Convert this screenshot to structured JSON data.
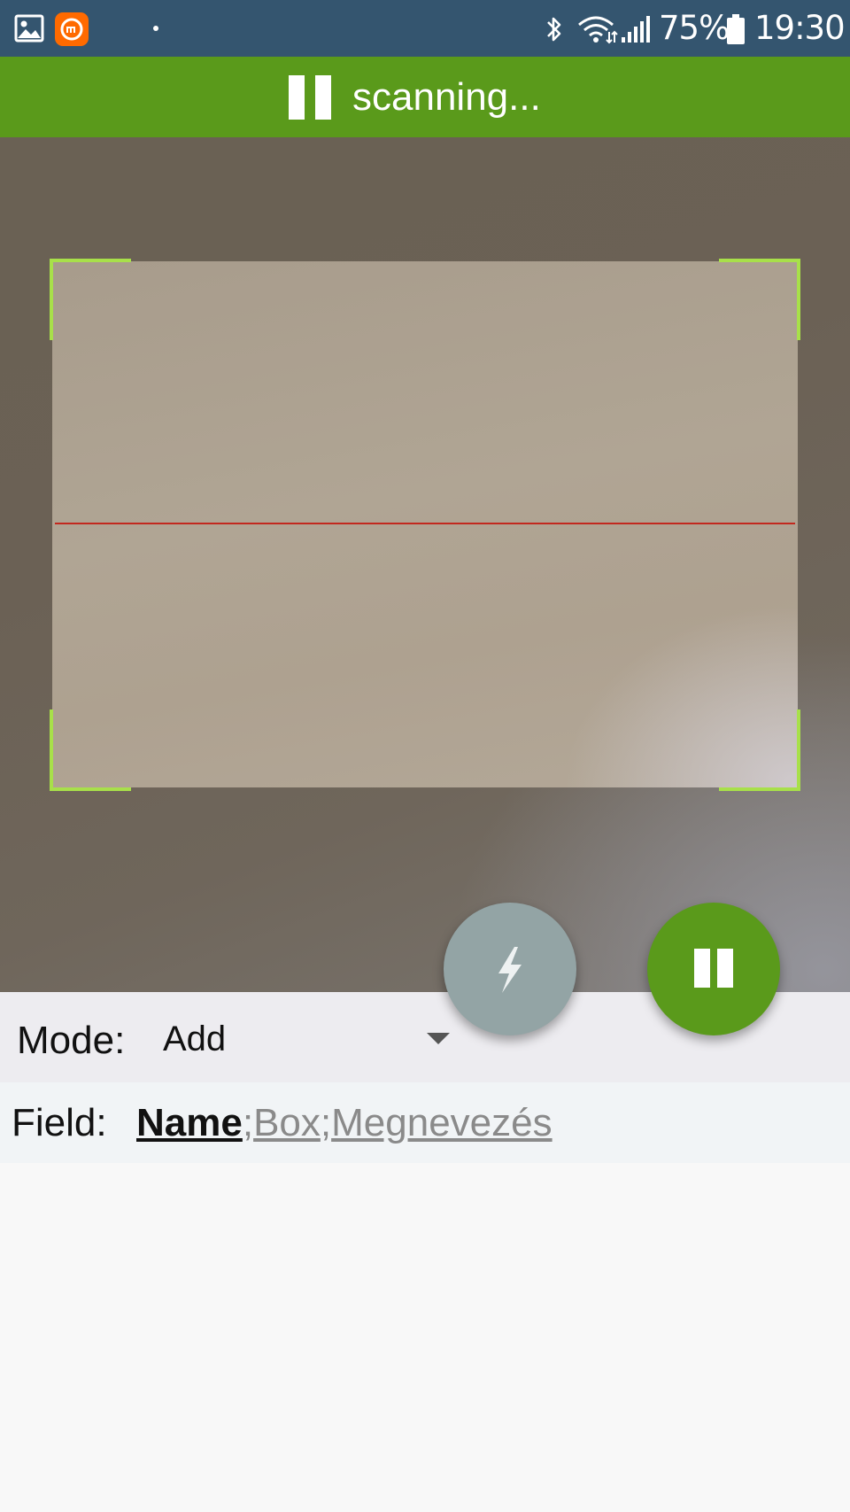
{
  "status_bar": {
    "battery_percent": "75%",
    "time": "19:30",
    "icons": [
      "gallery-icon",
      "mi-app-icon",
      "notification-dot-icon",
      "bluetooth-icon",
      "wifi-icon",
      "cell-signal-icon",
      "battery-icon"
    ]
  },
  "scan_header": {
    "status_text": "scanning...",
    "icon": "pause-icon"
  },
  "controls": {
    "mode_label": "Mode:",
    "mode_value": "Add",
    "field_label": "Field:",
    "fields": {
      "active": "Name",
      "separator": ";",
      "others": [
        "Box",
        "Megnevezés"
      ]
    }
  },
  "fabs": {
    "flash_icon": "flash-icon",
    "pause_icon": "pause-icon"
  },
  "colors": {
    "status_bar": "#34556f",
    "accent_green": "#5a9a1b",
    "viewfinder_corner": "#a8e04a",
    "scan_line": "#c2281e",
    "flash_fab": "#93a4a5"
  }
}
